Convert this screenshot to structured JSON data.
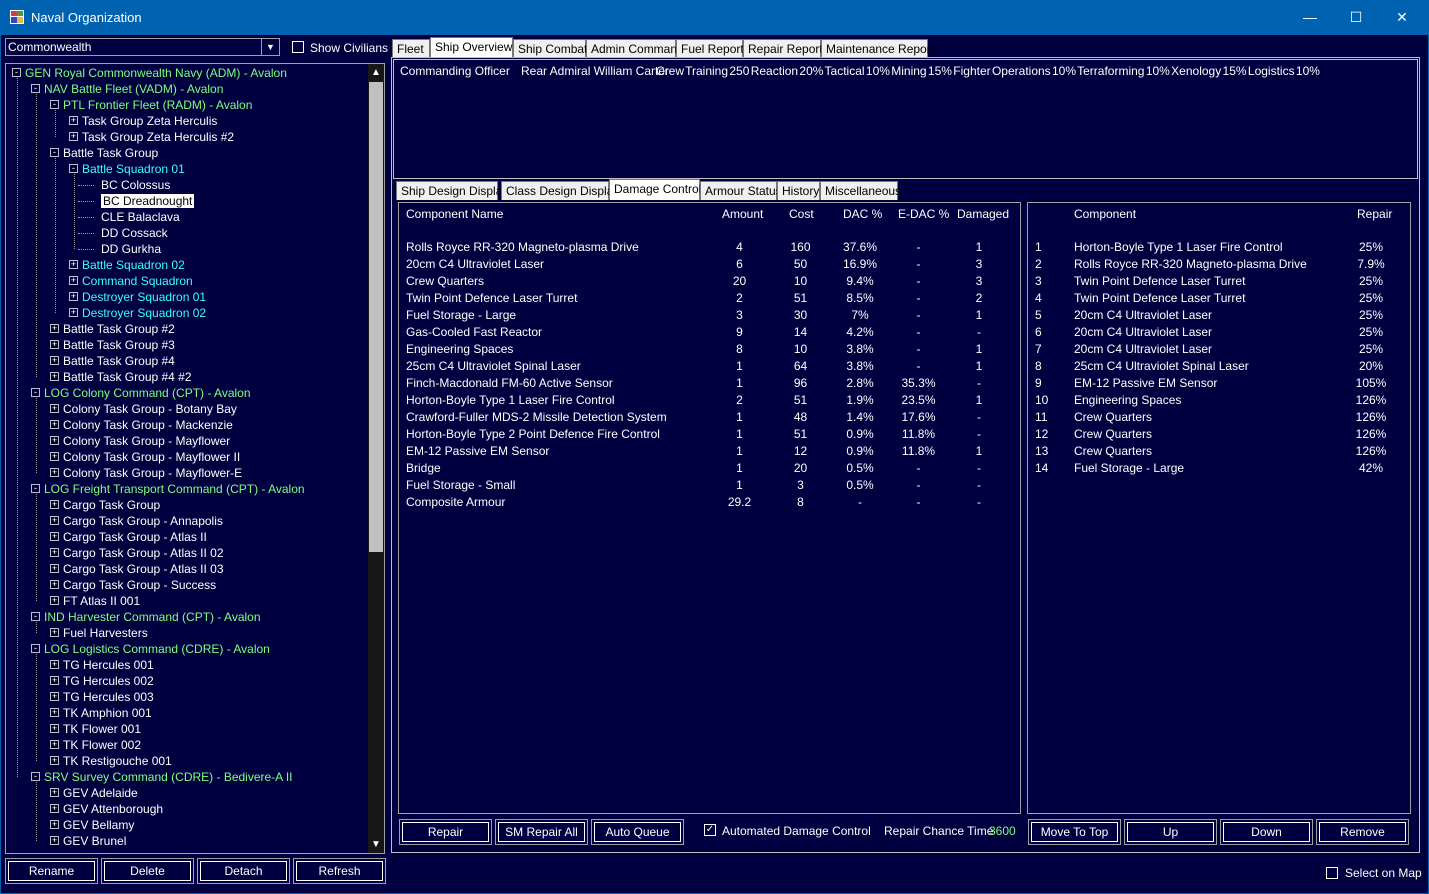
{
  "window": {
    "title": "Naval Organization",
    "min": "—",
    "max": "☐",
    "close": "✕"
  },
  "race_combo": {
    "value": "Commonwealth"
  },
  "show_civilians": {
    "label": "Show Civilians"
  },
  "tree": [
    {
      "level": 0,
      "box": "-",
      "text": "GEN Royal Commonwealth Navy (ADM)  -  Avalon",
      "color": "green"
    },
    {
      "level": 1,
      "box": "-",
      "text": "NAV Battle Fleet  (VADM)  -  Avalon",
      "color": "green"
    },
    {
      "level": 2,
      "box": "-",
      "text": "PTL Frontier Fleet  (RADM)  -  Avalon",
      "color": "green"
    },
    {
      "level": 3,
      "box": "+",
      "text": "Task Group Zeta Herculis",
      "color": "white"
    },
    {
      "level": 3,
      "box": "+",
      "text": "Task Group Zeta Herculis #2",
      "color": "white"
    },
    {
      "level": 2,
      "box": "-",
      "text": "Battle Task Group",
      "color": "white"
    },
    {
      "level": 3,
      "box": "-",
      "text": "Battle Squadron 01",
      "color": "cyan"
    },
    {
      "level": 4,
      "box": "",
      "text": "BC Colossus",
      "color": "white"
    },
    {
      "level": 4,
      "box": "",
      "text": "BC Dreadnought",
      "color": "white",
      "selected": true
    },
    {
      "level": 4,
      "box": "",
      "text": "CLE Balaclava",
      "color": "white"
    },
    {
      "level": 4,
      "box": "",
      "text": "DD Cossack",
      "color": "white"
    },
    {
      "level": 4,
      "box": "",
      "text": "DD Gurkha",
      "color": "white"
    },
    {
      "level": 3,
      "box": "+",
      "text": "Battle Squadron 02",
      "color": "cyan"
    },
    {
      "level": 3,
      "box": "+",
      "text": "Command Squadron",
      "color": "cyan"
    },
    {
      "level": 3,
      "box": "+",
      "text": "Destroyer Squadron 01",
      "color": "cyan"
    },
    {
      "level": 3,
      "box": "+",
      "text": "Destroyer Squadron 02",
      "color": "cyan"
    },
    {
      "level": 2,
      "box": "+",
      "text": "Battle Task Group #2",
      "color": "white"
    },
    {
      "level": 2,
      "box": "+",
      "text": "Battle Task Group #3",
      "color": "white"
    },
    {
      "level": 2,
      "box": "+",
      "text": "Battle Task Group #4",
      "color": "white"
    },
    {
      "level": 2,
      "box": "+",
      "text": "Battle Task Group #4 #2",
      "color": "white"
    },
    {
      "level": 1,
      "box": "-",
      "text": "LOG Colony Command  (CPT)  -  Avalon",
      "color": "green"
    },
    {
      "level": 2,
      "box": "+",
      "text": "Colony Task Group - Botany Bay",
      "color": "white"
    },
    {
      "level": 2,
      "box": "+",
      "text": "Colony Task Group - Mackenzie",
      "color": "white"
    },
    {
      "level": 2,
      "box": "+",
      "text": "Colony Task Group - Mayflower",
      "color": "white"
    },
    {
      "level": 2,
      "box": "+",
      "text": "Colony Task Group - Mayflower II",
      "color": "white"
    },
    {
      "level": 2,
      "box": "+",
      "text": "Colony Task Group - Mayflower-E",
      "color": "white"
    },
    {
      "level": 1,
      "box": "-",
      "text": "LOG Freight Transport Command  (CPT)  -  Avalon",
      "color": "green"
    },
    {
      "level": 2,
      "box": "+",
      "text": "Cargo Task Group",
      "color": "white"
    },
    {
      "level": 2,
      "box": "+",
      "text": "Cargo Task Group - Annapolis",
      "color": "white"
    },
    {
      "level": 2,
      "box": "+",
      "text": "Cargo Task Group - Atlas II",
      "color": "white"
    },
    {
      "level": 2,
      "box": "+",
      "text": "Cargo Task Group - Atlas II 02",
      "color": "white"
    },
    {
      "level": 2,
      "box": "+",
      "text": "Cargo Task Group - Atlas II 03",
      "color": "white"
    },
    {
      "level": 2,
      "box": "+",
      "text": "Cargo Task Group - Success",
      "color": "white"
    },
    {
      "level": 2,
      "box": "+",
      "text": "FT Atlas II 001",
      "color": "white"
    },
    {
      "level": 1,
      "box": "-",
      "text": "IND Harvester Command  (CPT)  -  Avalon",
      "color": "green"
    },
    {
      "level": 2,
      "box": "+",
      "text": "Fuel Harvesters",
      "color": "white"
    },
    {
      "level": 1,
      "box": "-",
      "text": "LOG Logistics Command  (CDRE)  -  Avalon",
      "color": "green"
    },
    {
      "level": 2,
      "box": "+",
      "text": "TG Hercules 001",
      "color": "white"
    },
    {
      "level": 2,
      "box": "+",
      "text": "TG Hercules 002",
      "color": "white"
    },
    {
      "level": 2,
      "box": "+",
      "text": "TG Hercules 003",
      "color": "white"
    },
    {
      "level": 2,
      "box": "+",
      "text": "TK Amphion 001",
      "color": "white"
    },
    {
      "level": 2,
      "box": "+",
      "text": "TK Flower 001",
      "color": "white"
    },
    {
      "level": 2,
      "box": "+",
      "text": "TK Flower 002",
      "color": "white"
    },
    {
      "level": 2,
      "box": "+",
      "text": "TK Restigouche 001",
      "color": "white"
    },
    {
      "level": 1,
      "box": "-",
      "text": "SRV Survey Command  (CDRE)  -  Bedivere-A II",
      "color": "green"
    },
    {
      "level": 2,
      "box": "+",
      "text": "GEV Adelaide",
      "color": "white"
    },
    {
      "level": 2,
      "box": "+",
      "text": "GEV Attenborough",
      "color": "white"
    },
    {
      "level": 2,
      "box": "+",
      "text": "GEV Bellamy",
      "color": "white"
    },
    {
      "level": 2,
      "box": "+",
      "text": "GEV Brunel",
      "color": "white"
    }
  ],
  "bottom_buttons": {
    "rename": "Rename",
    "delete": "Delete",
    "detach": "Detach",
    "refresh": "Refresh"
  },
  "top_tabs": [
    "Fleet",
    "Ship Overview",
    "Ship Combat",
    "Admin Command",
    "Fuel Report",
    "Repair Report",
    "Maintenance Report"
  ],
  "commander": {
    "label": "Commanding Officer",
    "name": "Rear Admiral William Carter",
    "stats": "Crew Training 250   Reaction 20%   Tactical 10%   Mining 15%   Fighter Operations 10%   Terraforming 10%   Xenology 15%   Logistics 10%"
  },
  "sub_tabs": [
    "Ship Design Display",
    "Class Design Display",
    "Damage Control",
    "Armour Status",
    "History",
    "Miscellaneous"
  ],
  "damage_table": {
    "headers": [
      "Component Name",
      "Amount",
      "Cost",
      "DAC %",
      "E-DAC %",
      "Damaged"
    ],
    "rows": [
      [
        "Rolls Royce RR-320 Magneto-plasma Drive",
        "4",
        "160",
        "37.6%",
        "-",
        "1"
      ],
      [
        "20cm C4 Ultraviolet Laser",
        "6",
        "50",
        "16.9%",
        "-",
        "3"
      ],
      [
        "Crew Quarters",
        "20",
        "10",
        "9.4%",
        "-",
        "3"
      ],
      [
        "Twin Point Defence Laser Turret",
        "2",
        "51",
        "8.5%",
        "-",
        "2"
      ],
      [
        "Fuel Storage - Large",
        "3",
        "30",
        "7%",
        "-",
        "1"
      ],
      [
        "Gas-Cooled Fast Reactor",
        "9",
        "14",
        "4.2%",
        "-",
        "-"
      ],
      [
        "Engineering Spaces",
        "8",
        "10",
        "3.8%",
        "-",
        "1"
      ],
      [
        "25cm C4 Ultraviolet Spinal Laser",
        "1",
        "64",
        "3.8%",
        "-",
        "1"
      ],
      [
        "Finch-Macdonald FM-60 Active Sensor",
        "1",
        "96",
        "2.8%",
        "35.3%",
        "-"
      ],
      [
        "Horton-Boyle Type 1 Laser Fire Control",
        "2",
        "51",
        "1.9%",
        "23.5%",
        "1"
      ],
      [
        "Crawford-Fuller MDS-2 Missile Detection System",
        "1",
        "48",
        "1.4%",
        "17.6%",
        "-"
      ],
      [
        "Horton-Boyle Type 2 Point Defence Fire Control",
        "1",
        "51",
        "0.9%",
        "11.8%",
        "-"
      ],
      [
        "EM-12 Passive EM Sensor",
        "1",
        "12",
        "0.9%",
        "11.8%",
        "1"
      ],
      [
        "Bridge",
        "1",
        "20",
        "0.5%",
        "-",
        "-"
      ],
      [
        "Fuel Storage - Small",
        "1",
        "3",
        "0.5%",
        "-",
        "-"
      ],
      [
        "Composite Armour",
        "29.2",
        "8",
        "-",
        "-",
        "-"
      ]
    ]
  },
  "repair_table": {
    "headers": [
      "Component",
      "Repair"
    ],
    "rows": [
      [
        "1",
        "Horton-Boyle Type 1 Laser Fire Control",
        "25%"
      ],
      [
        "2",
        "Rolls Royce RR-320 Magneto-plasma Drive",
        "7.9%"
      ],
      [
        "3",
        "Twin Point Defence Laser Turret",
        "25%"
      ],
      [
        "4",
        "Twin Point Defence Laser Turret",
        "25%"
      ],
      [
        "5",
        "20cm C4 Ultraviolet Laser",
        "25%"
      ],
      [
        "6",
        "20cm C4 Ultraviolet Laser",
        "25%"
      ],
      [
        "7",
        "20cm C4 Ultraviolet Laser",
        "25%"
      ],
      [
        "8",
        "25cm C4 Ultraviolet Spinal Laser",
        "20%"
      ],
      [
        "9",
        "EM-12 Passive EM Sensor",
        "105%"
      ],
      [
        "10",
        "Engineering Spaces",
        "126%"
      ],
      [
        "11",
        "Crew Quarters",
        "126%"
      ],
      [
        "12",
        "Crew Quarters",
        "126%"
      ],
      [
        "13",
        "Crew Quarters",
        "126%"
      ],
      [
        "14",
        "Fuel Storage - Large",
        "42%"
      ]
    ]
  },
  "dc_buttons": {
    "repair": "Repair",
    "sm_repair": "SM Repair All",
    "auto_queue": "Auto Queue",
    "move_top": "Move To Top",
    "up": "Up",
    "down": "Down",
    "remove": "Remove"
  },
  "auto_dc": {
    "label": "Automated Damage Control",
    "checked": true
  },
  "repair_chance": {
    "label": "Repair Chance Time",
    "value": "3600"
  },
  "select_on_map": {
    "label": "Select on Map"
  },
  "colors": {
    "titlebar": "#0063b1",
    "background": "#000040",
    "green": "#7dff7d",
    "cyan": "#38ffff"
  }
}
